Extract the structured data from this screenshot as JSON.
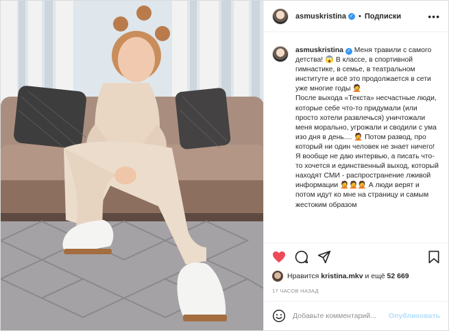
{
  "post": {
    "author": "asmuskristina",
    "follow_label": "Подписки",
    "dot": "•",
    "more_icon": "more-icon",
    "caption_lines": [
      "Меня травили с самого детства! 😱 В классе, в спортивной гимнастике, в семье, в театральном институте и всё это продолжается в сети уже многие годы 🤦",
      "После выхода «Текста» несчастные люди, которые себе что-то придумали (или просто хотели развлечься) уничтожали меня морально, угрожали и сводили с ума изо дня в день.... 🤦 Потом развод, про который ни один человек не знает ничего! Я вообще не даю интервью, а писать что-то хочется и единственный выход, который находят СМИ - распространение лживой информации 🤦🤦🤦 А люди верят и потом идут ко мне на страницу и самым жестоким образом"
    ],
    "likes_prefix": "Нравится",
    "likes_user": "kristina.mkv",
    "likes_middle": "и ещё",
    "likes_count": "52 669",
    "time_ago": "17 часов назад",
    "comment_placeholder": "Добавьте комментарий...",
    "publish_label": "Опубликовать",
    "colors": {
      "like": "#ed4956",
      "link": "#3897f0",
      "publish_disabled": "#b2dffc",
      "muted": "#8e8e8e"
    }
  }
}
